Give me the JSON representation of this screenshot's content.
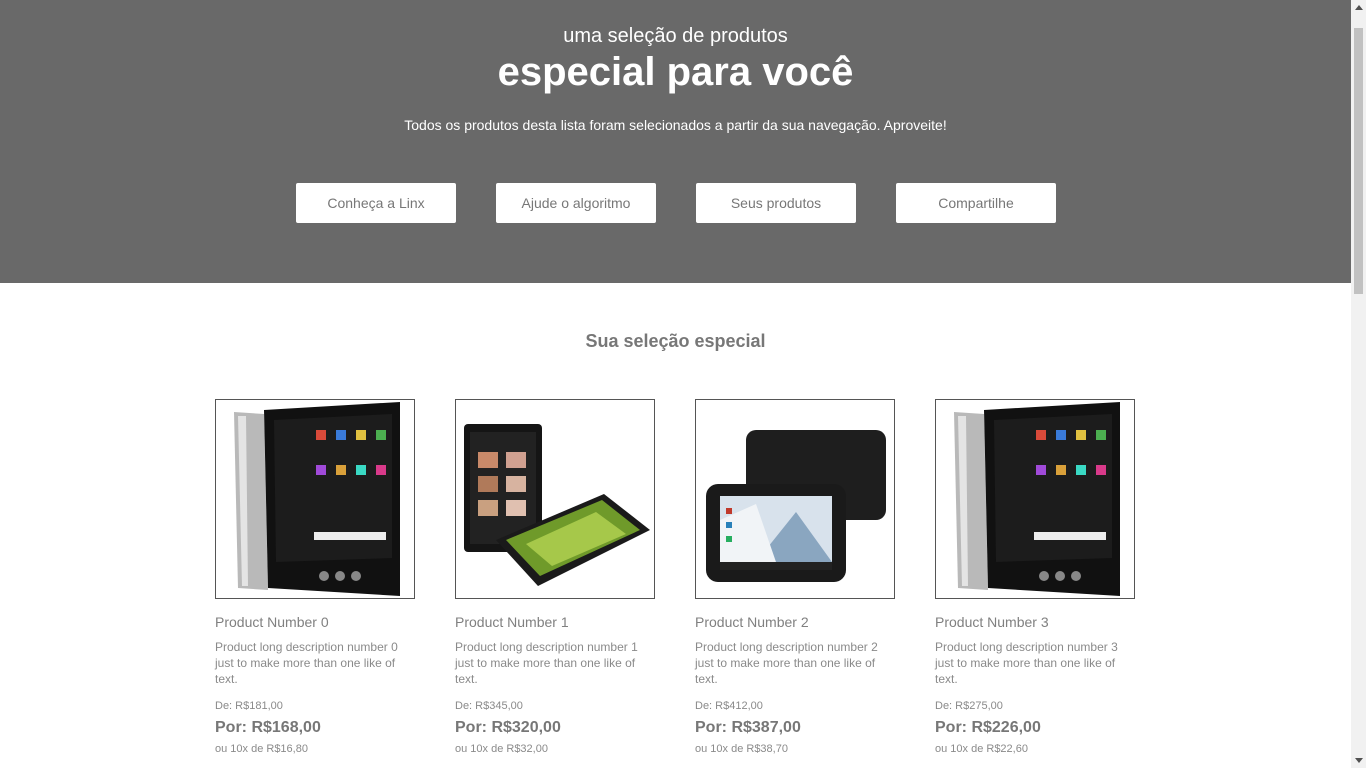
{
  "hero": {
    "kicker": "uma seleção de produtos",
    "title": "especial para você",
    "subtitle": "Todos os produtos desta lista foram selecionados a partir da sua navegação. Aproveite!",
    "buttons": [
      {
        "label": "Conheça a Linx"
      },
      {
        "label": "Ajude o algoritmo"
      },
      {
        "label": "Seus produtos"
      },
      {
        "label": "Compartilhe"
      }
    ]
  },
  "section": {
    "title": "Sua seleção especial"
  },
  "products": [
    {
      "name": "Product Number 0",
      "description": "Product long description number 0 just to make more than one like of text.",
      "price_from": "De: R$181,00",
      "price_for": "Por: R$168,00",
      "installments": "ou 10x de R$16,80",
      "image_icon": "tablet-silver-image"
    },
    {
      "name": "Product Number 1",
      "description": "Product long description number 1 just to make more than one like of text.",
      "price_from": "De: R$345,00",
      "price_for": "Por: R$320,00",
      "installments": "ou 10x de R$32,00",
      "image_icon": "tablet-pair-image"
    },
    {
      "name": "Product Number 2",
      "description": "Product long description number 2 just to make more than one like of text.",
      "price_from": "De: R$412,00",
      "price_for": "Por: R$387,00",
      "installments": "ou 10x de R$38,70",
      "image_icon": "tablet-black-image"
    },
    {
      "name": "Product Number 3",
      "description": "Product long description number 3 just to make more than one like of text.",
      "price_from": "De: R$275,00",
      "price_for": "Por: R$226,00",
      "installments": "ou 10x de R$22,60",
      "image_icon": "tablet-silver-image"
    }
  ],
  "colors": {
    "hero_background": "#696969",
    "text_gray": "#777777"
  }
}
